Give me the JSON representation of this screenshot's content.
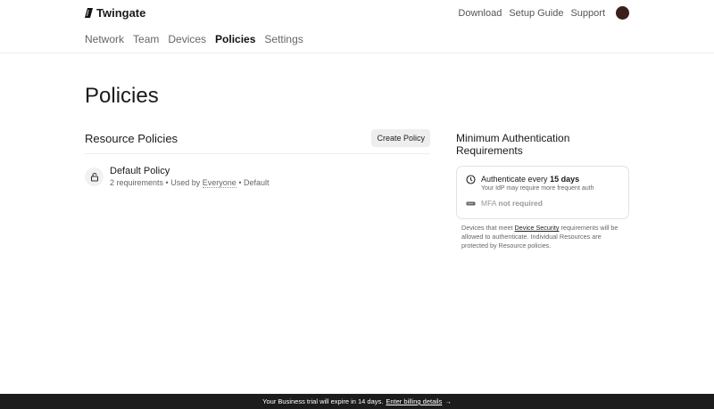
{
  "brand": "Twingate",
  "top_links": [
    "Download",
    "Setup Guide",
    "Support"
  ],
  "nav": [
    "Network",
    "Team",
    "Devices",
    "Policies",
    "Settings"
  ],
  "active_nav": "Policies",
  "page_title": "Policies",
  "resource": {
    "title": "Resource Policies",
    "create_label": "Create Policy",
    "policy": {
      "name": "Default Policy",
      "requirements": "2 requirements",
      "used_by_prefix": "Used by",
      "used_by": "Everyone",
      "tag": "Default",
      "sep": "•"
    }
  },
  "auth": {
    "title": "Minimum Authentication Requirements",
    "line_prefix": "Authenticate every",
    "line_value": "15 days",
    "sub": "Your IdP may require more frequent auth",
    "mfa_prefix": "MFA",
    "mfa_value": "not required",
    "note_pre": "Devices that meet",
    "note_link": "Device Security",
    "note_post": "requirements will be allowed to authenticate. Individual Resources are protected by Resource policies."
  },
  "banner": {
    "text": "Your Business trial will expire in 14 days.",
    "link": "Enter billing details",
    "arrow": "→"
  }
}
